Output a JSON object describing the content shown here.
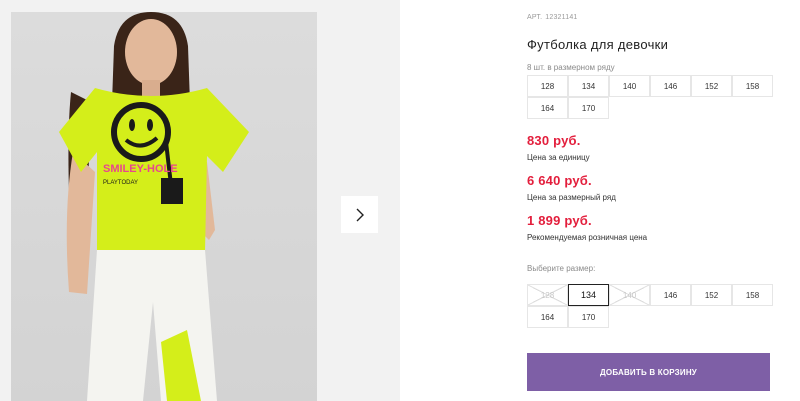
{
  "product": {
    "article_label": "АРТ.",
    "article_number": "12321141",
    "title": "Футболка для девочки"
  },
  "pack": {
    "note": "8 шт. в размерном ряду",
    "sizes": [
      "128",
      "134",
      "140",
      "146",
      "152",
      "158",
      "164",
      "170"
    ]
  },
  "prices": {
    "unit_price": "830 руб.",
    "unit_label": "Цена за единицу",
    "pack_price": "6 640 руб.",
    "pack_label": "Цена за размерный ряд",
    "retail_price": "1 899 руб.",
    "retail_label": "Рекомендуемая розничная цена"
  },
  "size_picker": {
    "label": "Выберите размер:",
    "sizes": [
      {
        "value": "128",
        "available": false,
        "selected": false
      },
      {
        "value": "134",
        "available": true,
        "selected": true
      },
      {
        "value": "140",
        "available": false,
        "selected": false
      },
      {
        "value": "146",
        "available": true,
        "selected": false
      },
      {
        "value": "152",
        "available": true,
        "selected": false
      },
      {
        "value": "158",
        "available": true,
        "selected": false
      },
      {
        "value": "164",
        "available": true,
        "selected": false
      },
      {
        "value": "170",
        "available": true,
        "selected": false
      }
    ]
  },
  "cart": {
    "add_label": "ДОБАВИТЬ В КОРЗИНУ"
  },
  "gallery": {
    "next_icon": "chevron-right-icon",
    "print_text": "SMILEY-HOLE",
    "print_subtext": "PLAYTODAY"
  },
  "colors": {
    "accent": "#7e5fa6",
    "price": "#e31e3c",
    "tshirt": "#d4ee1a"
  }
}
